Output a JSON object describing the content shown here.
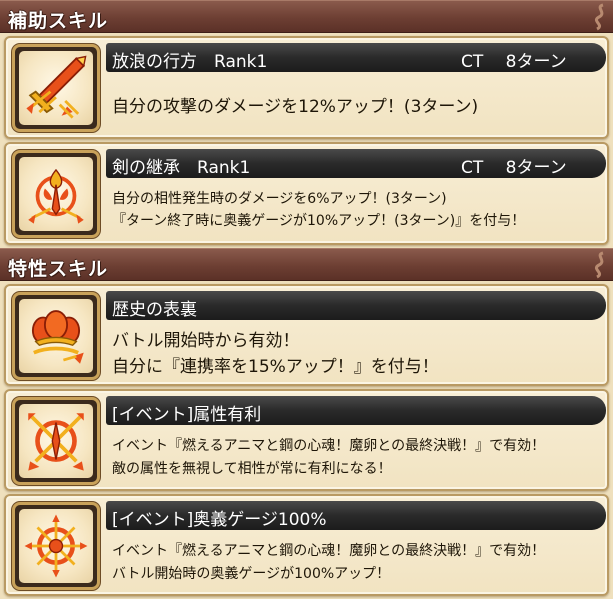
{
  "sections": {
    "support": {
      "title": "補助スキル"
    },
    "trait": {
      "title": "特性スキル"
    }
  },
  "support_skills": [
    {
      "name": "放浪の行方　Rank1",
      "ct": "CT　 8ターン",
      "desc": [
        "自分の攻撃のダメージを12%アップ！(3ターン)"
      ],
      "icon": "sword-arrows-icon"
    },
    {
      "name": "剣の継承　Rank1",
      "ct": "CT　 8ターン",
      "desc": [
        "自分の相性発生時のダメージを6%アップ！(3ターン)",
        "『ターン終了時に奥義ゲージが10%アップ！(3ターン)』を付与！"
      ],
      "icon": "flame-sword-emblem-icon"
    }
  ],
  "trait_skills": [
    {
      "name": "歴史の表裏",
      "desc": [
        "バトル開始時から有効！",
        "自分に『連携率を15%アップ！』を付与！"
      ],
      "icon": "triple-flame-icon"
    },
    {
      "name": "[イベント]属性有利",
      "desc": [
        "イベント『燃えるアニマと鋼の心魂！魔卵との最終決戦！』で有効！",
        "敵の属性を無視して相性が常に有利になる！"
      ],
      "icon": "crossed-arrows-emblem-icon"
    },
    {
      "name": "[イベント]奥義ゲージ100%",
      "desc": [
        "イベント『燃えるアニマと鋼の心魂！魔卵との最終決戦！』で有効！",
        "バトル開始時の奥義ゲージが100%アップ！"
      ],
      "icon": "radiant-burst-icon"
    }
  ],
  "colors": {
    "header": "#6d3f33",
    "card_bg": "#f4e8cc",
    "name_bar": "#2a2a2a",
    "icon_fire": "#e8501a",
    "icon_gold": "#f2b01e"
  }
}
